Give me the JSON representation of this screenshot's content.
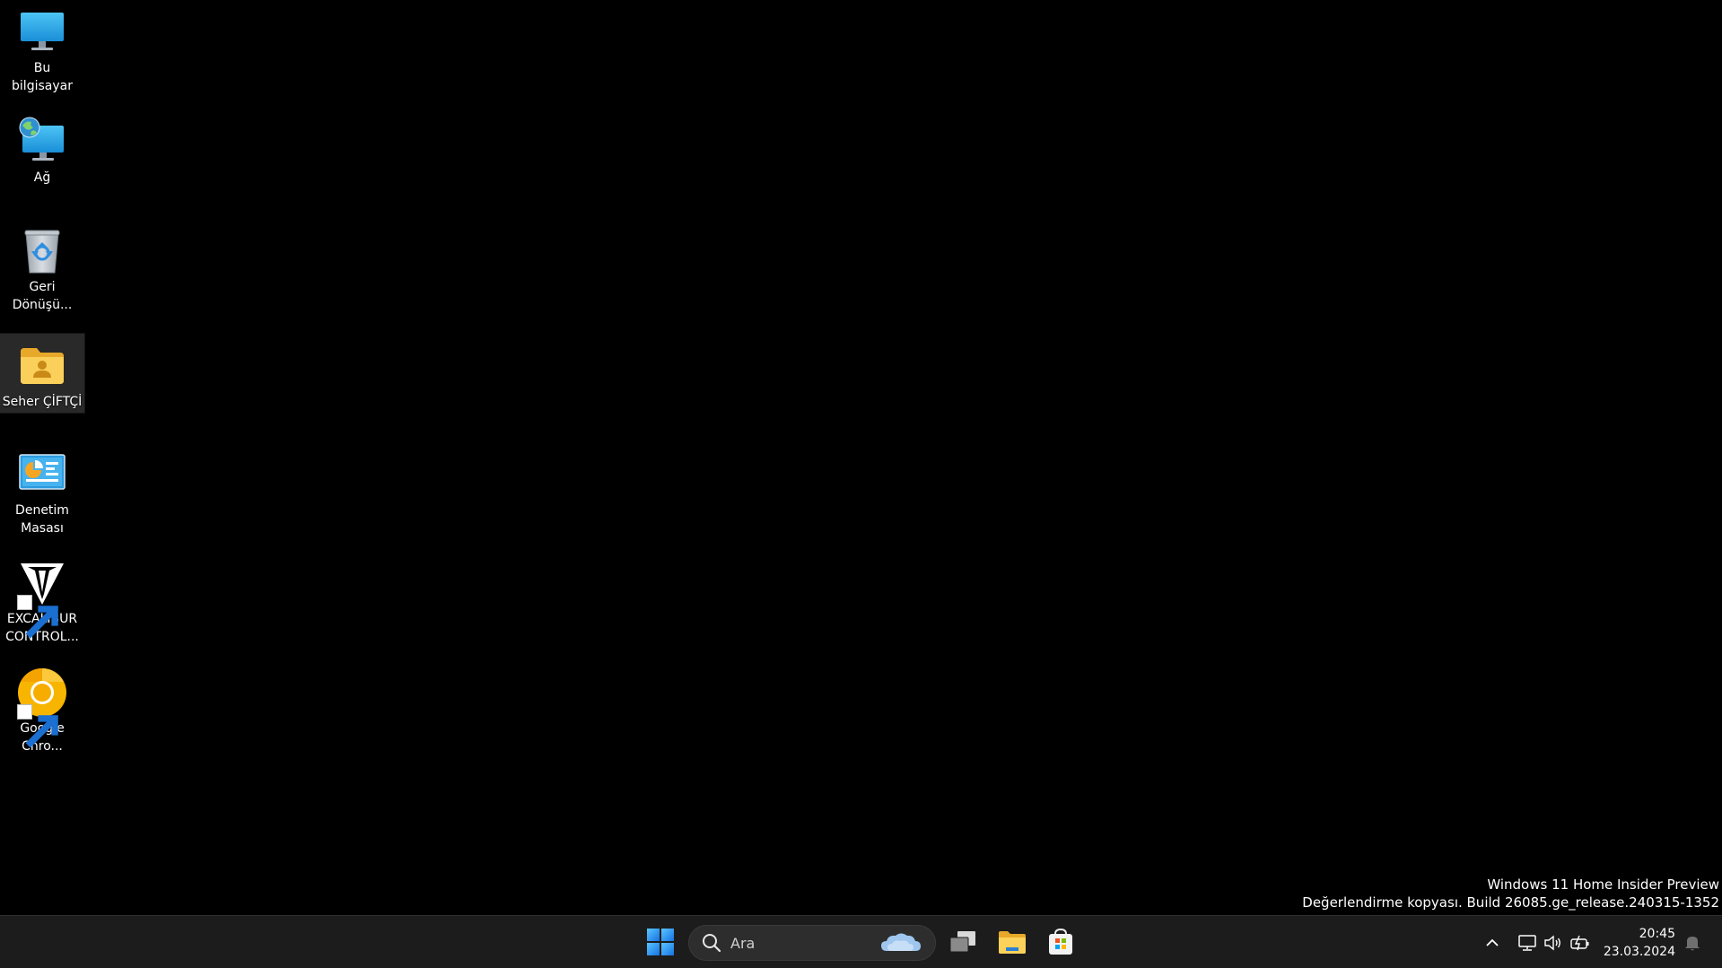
{
  "desktop": {
    "icons": [
      {
        "label": "Bu bilgisayar",
        "icon": "computer-icon",
        "shortcut": false,
        "selected": false
      },
      {
        "label": "Ağ",
        "icon": "network-icon",
        "shortcut": false,
        "selected": false
      },
      {
        "label": "Geri\nDönüşü...",
        "icon": "recycle-bin-icon",
        "shortcut": false,
        "selected": false
      },
      {
        "label": "Seher ÇİFTÇİ",
        "icon": "user-folder-icon",
        "shortcut": false,
        "selected": true
      },
      {
        "label": "Denetim\nMasası",
        "icon": "control-panel-icon",
        "shortcut": false,
        "selected": false
      },
      {
        "label": "EXCALIBUR\nCONTROL...",
        "icon": "excalibur-icon",
        "shortcut": true,
        "selected": false
      },
      {
        "label": "Google\nChro...",
        "icon": "chrome-canary-icon",
        "shortcut": true,
        "selected": false
      }
    ]
  },
  "watermark": {
    "line1": "Windows 11 Home Insider Preview",
    "line2": "Değerlendirme kopyası. Build 26085.ge_release.240315-1352"
  },
  "taskbar": {
    "search_placeholder": "Ara",
    "pinned": [
      "start-icon",
      "task-view-icon",
      "file-explorer-icon",
      "microsoft-store-icon"
    ],
    "tray": [
      "chevron-up-icon",
      "network-icon",
      "volume-icon",
      "battery-icon",
      "bell-icon"
    ],
    "clock": {
      "time": "20:45",
      "date": "23.03.2024"
    }
  },
  "colors": {
    "desktop_bg": "#000000",
    "taskbar_bg": "#1c1c1c",
    "start_blue": "#3a9cf2"
  }
}
